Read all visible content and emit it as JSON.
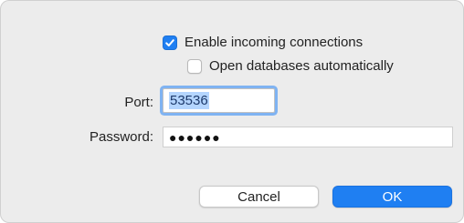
{
  "checkboxes": [
    {
      "label": "Enable incoming connections",
      "checked": true
    },
    {
      "label": "Open databases automatically",
      "checked": false
    }
  ],
  "port": {
    "label": "Port:",
    "value": "53536"
  },
  "password": {
    "label": "Password:",
    "masked_value": "●●●●●●"
  },
  "buttons": {
    "cancel_label": "Cancel",
    "ok_label": "OK"
  },
  "colors": {
    "accent": "#1f7ff2",
    "focus_ring": "#7fb3f2",
    "selection": "#b4d5fe",
    "dialog_background": "#ececec"
  }
}
